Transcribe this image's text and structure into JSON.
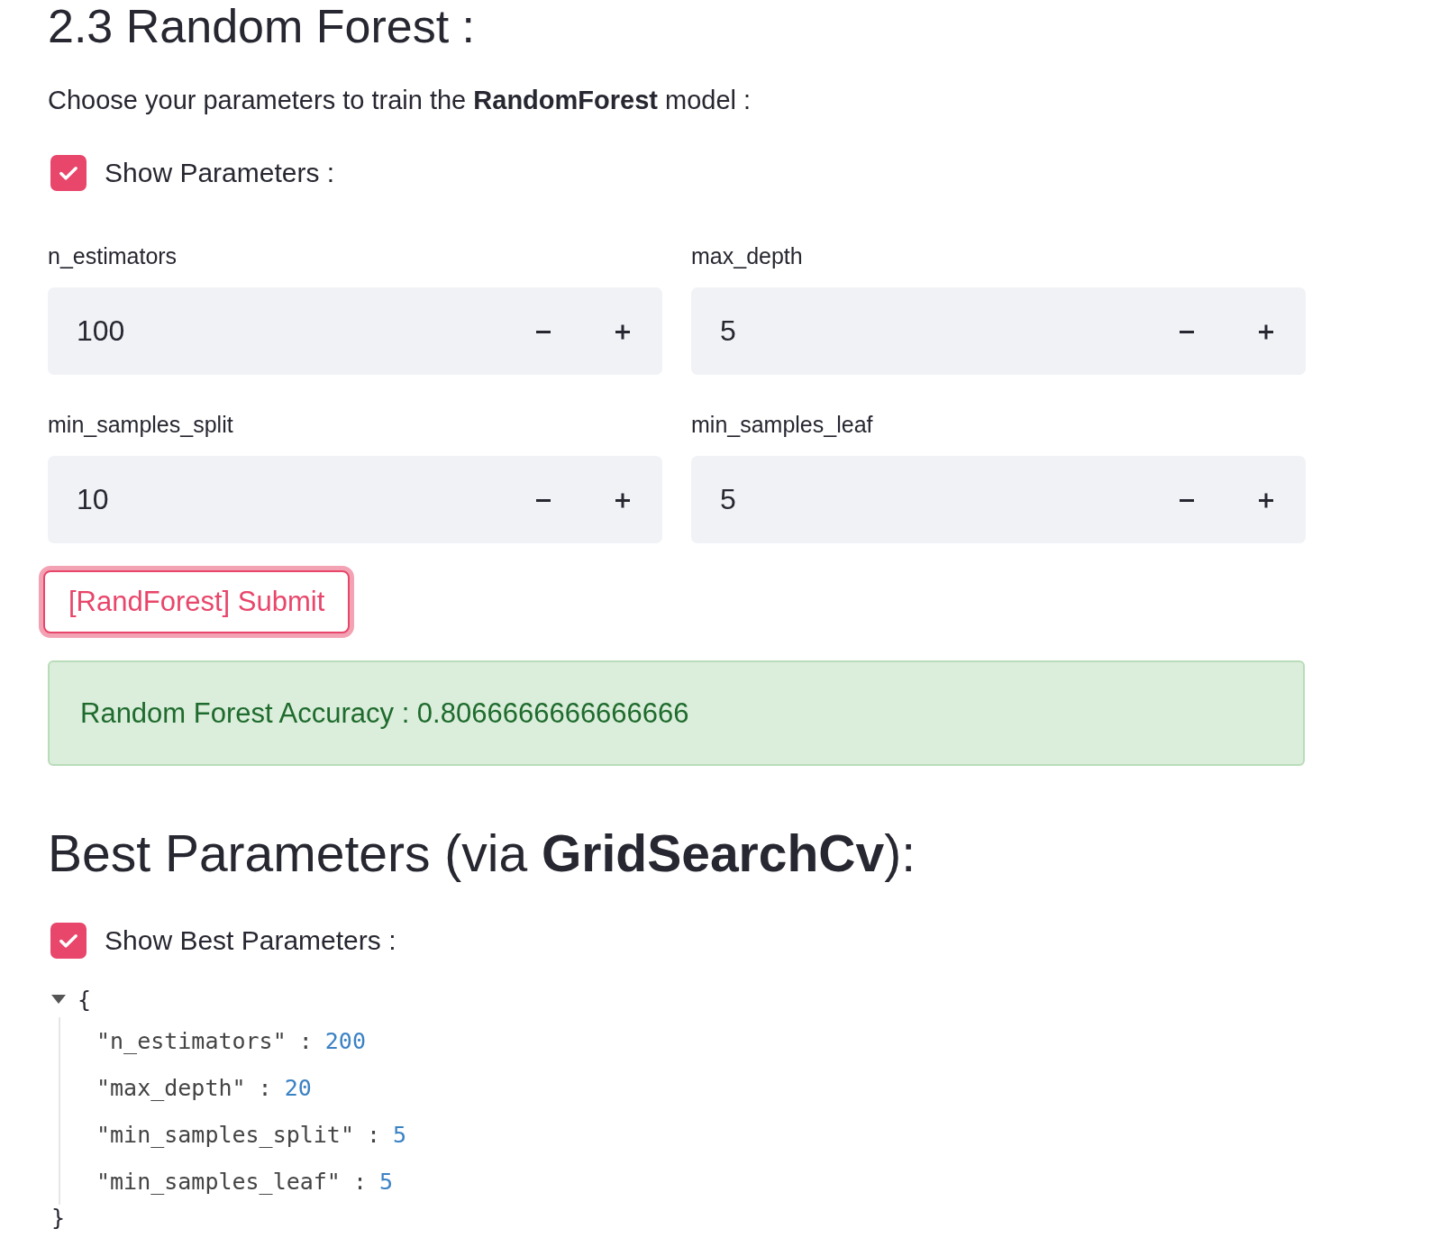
{
  "heading": "2.3 Random Forest :",
  "intro": "Choose your parameters to train the **RandomForest** model :",
  "show_parameters": {
    "label": "Show Parameters :",
    "checked": true
  },
  "inputs": [
    {
      "label": "n_estimators",
      "value": "100"
    },
    {
      "label": "max_depth",
      "value": "5"
    },
    {
      "label": "min_samples_split",
      "value": "10"
    },
    {
      "label": "min_samples_leaf",
      "value": "5"
    }
  ],
  "submit_button": {
    "label": "[RandForest] Submit",
    "focused": true
  },
  "result": {
    "kind": "success",
    "text": "Random Forest Accuracy : 0.8066666666666666"
  },
  "best_heading": "Best Parameters (via **GridSearchCv**):",
  "show_best": {
    "label": "Show Best Parameters :",
    "checked": true
  },
  "json_view": {
    "expanded": true,
    "open_brace": "{",
    "close_brace": "}",
    "entries": [
      {
        "key": "\"n_estimators\"",
        "separator": ":",
        "value": "200"
      },
      {
        "key": "\"max_depth\"",
        "separator": ":",
        "value": "20"
      },
      {
        "key": "\"min_samples_split\"",
        "separator": ":",
        "value": "5"
      },
      {
        "key": "\"min_samples_leaf\"",
        "separator": ":",
        "value": "5"
      }
    ]
  }
}
